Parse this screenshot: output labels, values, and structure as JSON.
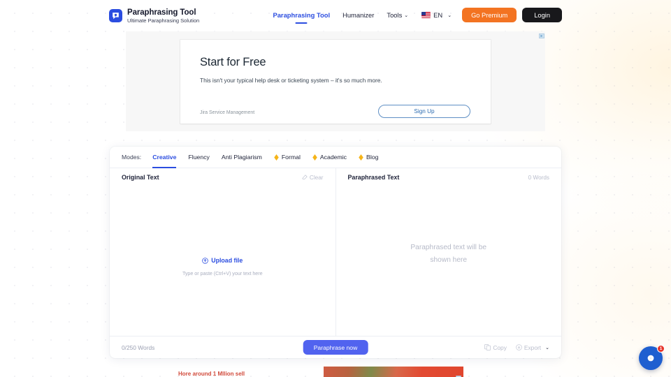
{
  "brand": {
    "title": "Paraphrasing Tool",
    "subtitle": "Ultimate Paraphrasing Solution",
    "logo_icon": "speech-bubble-p-icon",
    "logo_color": "#2b4de0"
  },
  "nav": {
    "links": [
      {
        "label": "Paraphrasing Tool",
        "active": true,
        "has_caret": false
      },
      {
        "label": "Humanizer",
        "active": false,
        "has_caret": false
      },
      {
        "label": "Tools",
        "active": false,
        "has_caret": true
      }
    ],
    "caret_glyph": "⌄",
    "language": {
      "label": "EN",
      "flag_icon": "us-flag-icon",
      "caret_glyph": "⌄"
    },
    "premium_button": {
      "label": "Go Premium",
      "color": "#f37321"
    },
    "login_button": {
      "label": "Login",
      "color": "#18181b"
    }
  },
  "ad": {
    "info_icon": "ad-choices-icon",
    "headline": "Start for Free",
    "body": "This isn't your typical help desk or ticketing system – it's so much more.",
    "advertiser": "Jira Service Management",
    "cta": "Sign Up"
  },
  "modes": {
    "label": "Modes:",
    "items": [
      {
        "label": "Creative",
        "active": true,
        "premium": false
      },
      {
        "label": "Fluency",
        "active": false,
        "premium": false
      },
      {
        "label": "Anti Plagiarism",
        "active": false,
        "premium": false
      },
      {
        "label": "Formal",
        "active": false,
        "premium": true
      },
      {
        "label": "Academic",
        "active": false,
        "premium": true
      },
      {
        "label": "Blog",
        "active": false,
        "premium": true
      }
    ],
    "premium_icon": "gem-icon",
    "premium_icon_color": "#f5b419",
    "active_color": "#2b4de0"
  },
  "editor": {
    "left": {
      "title": "Original Text",
      "clear_label": "Clear",
      "clear_icon": "eraser-icon",
      "upload_label": "Upload file",
      "upload_icon": "upload-circle-icon",
      "placeholder": "Type or paste (Ctrl+V) your text here",
      "value": ""
    },
    "right": {
      "title": "Paraphrased Text",
      "words_count": "0 Words",
      "placeholder_line1": "Paraphrased text will be",
      "placeholder_line2": "shown here",
      "value": ""
    }
  },
  "footer": {
    "word_counter": "0/250 Words",
    "paraphrase_button": {
      "label": "Paraphrase now",
      "color": "#5163ef"
    },
    "copy": {
      "label": "Copy",
      "icon": "copy-icon"
    },
    "export": {
      "label": "Export",
      "icon": "download-circle-icon",
      "caret_glyph": "⌄"
    }
  },
  "bottom_ad": {
    "text": "Hore around 1 Mllion sell",
    "info_icon": "ad-choices-icon"
  },
  "chat": {
    "icon": "chat-bubble-icon",
    "badge_count": "1",
    "color": "#1f5fd0",
    "badge_color": "#e8342a"
  }
}
